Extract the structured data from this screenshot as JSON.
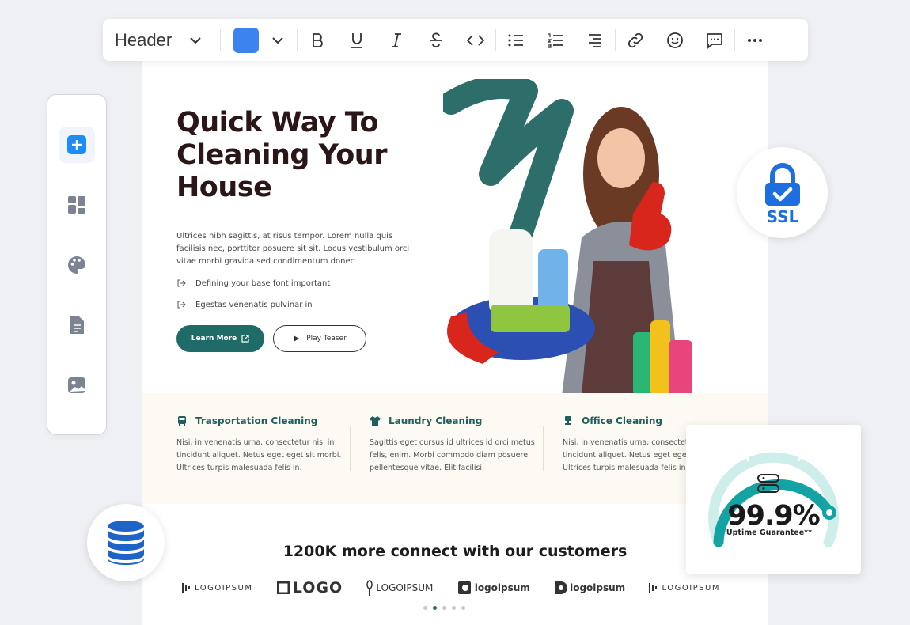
{
  "toolbar": {
    "block_type": "Header",
    "color": "#3d83f0",
    "buttons": [
      "bold-icon",
      "underline-icon",
      "italic-icon",
      "strikethrough-icon",
      "code-icon",
      "bullet-list-icon",
      "numbered-list-icon",
      "align-right-icon",
      "link-icon",
      "emoji-icon",
      "comment-icon",
      "more-icon"
    ]
  },
  "sidebar": {
    "items": [
      "add-block-icon",
      "layout-icon",
      "palette-icon",
      "document-icon",
      "image-icon"
    ]
  },
  "hero": {
    "title": "Quick Way To\nCleaning Your\nHouse",
    "description": "Ultrices nibh sagittis, at risus tempor. Lorem nulla quis facilisis nec, porttitor posuere sit sit. Locus vestibulum orci vitae morbi gravida sed condimentum donec",
    "bullets": [
      "Defining your base font important",
      "Egestas venenatis pulvinar in"
    ],
    "primary_button": "Learn More",
    "secondary_button": "Play Teaser"
  },
  "services": [
    {
      "title": "Trasportation Cleaning",
      "text": "Nisi, in venenatis urna, consectetur nisl in tincidunt aliquet. Netus eget eget sit morbi. Ultrices turpis malesuada felis in."
    },
    {
      "title": "Laundry Cleaning",
      "text": "Sagittis eget cursus id ultrices id orci metus felis, enim. Morbi commodo diam posuere pellentesque vitae. Elit facilisi."
    },
    {
      "title": "Office Cleaning",
      "text": "Nisi, in venenatis urna, consectetur nisl in tincidunt aliquet. Netus eget eget sit morbi. Ultrices turpis malesuada felis in."
    }
  ],
  "customers": {
    "title": "1200K  more connect with our customers",
    "logos": [
      "LOGOIPSUM",
      "LOGO",
      "LOGOIPSUM",
      "logoipsum",
      "logoipsum",
      "LOGOIPSUM"
    ],
    "carousel_active_index": 1,
    "carousel_count": 5
  },
  "ssl_badge": {
    "text": "SSL"
  },
  "uptime": {
    "value": "99.9%",
    "label": "Uptime Guarantee**",
    "gauge_fraction": 0.999,
    "color": "#13a3a3"
  },
  "colors": {
    "brand": "#1f6b67",
    "accent": "#3d83f0"
  }
}
